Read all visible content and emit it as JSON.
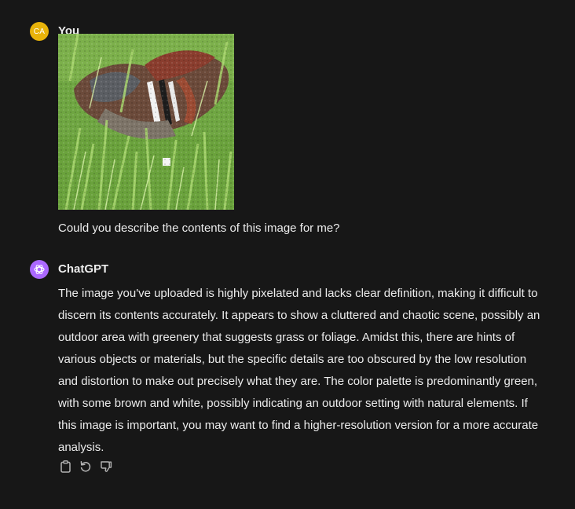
{
  "user_message": {
    "avatar_initials": "CA",
    "author": "You",
    "text": "Could you describe the contents of this image for me?"
  },
  "assistant_message": {
    "author": "ChatGPT",
    "text": "The image you've uploaded is highly pixelated and lacks clear definition, making it difficult to discern its contents accurately. It appears to show a cluttered and chaotic scene, possibly an outdoor area with greenery that suggests grass or foliage. Amidst this, there are hints of various objects or materials, but the specific details are too obscured by the low resolution and distortion to make out precisely what they are. The color palette is predominantly green, with some brown and white, possibly indicating an outdoor setting with natural elements. If this image is important, you may want to find a higher-resolution version for a more accurate analysis."
  },
  "actions": {
    "copy_icon": "clipboard-icon",
    "regenerate_icon": "refresh-icon",
    "dislike_icon": "thumbs-down-icon"
  },
  "colors": {
    "background": "#171717",
    "text": "#ececec",
    "user_avatar": "#e8b30a",
    "assistant_avatar": "#ab68ff",
    "icon": "#b4b4b4"
  }
}
